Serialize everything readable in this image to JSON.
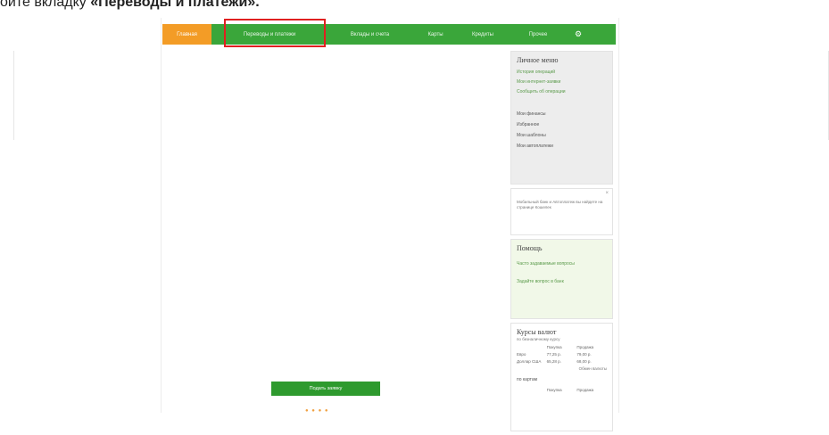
{
  "caption": {
    "prefix": "оите вкладку ",
    "bold": "«Переводы и платежи»."
  },
  "nav": {
    "tabs": [
      {
        "label": "Главная",
        "active": true
      },
      {
        "label": "Переводы и платежи",
        "active": false
      },
      {
        "label": "Вклады и счета",
        "active": false
      },
      {
        "label": "Карты",
        "active": false
      },
      {
        "label": "Кредиты",
        "active": false
      },
      {
        "label": "Прочее",
        "active": false
      }
    ],
    "settings_icon": "gear-icon"
  },
  "sidebar": {
    "cabinet": {
      "title": "Личное меню",
      "links": [
        "История операций",
        "Мои интернет-заявки",
        "Сообщить об операции"
      ],
      "items": [
        "Мои финансы",
        "Избранное",
        "Мои шаблоны",
        "Мои автоплатежи"
      ]
    },
    "promo": {
      "text": "Мобильный банк и Автоплатеж вы найдете на странице Кошелек"
    },
    "help": {
      "title": "Помощь",
      "links": [
        "Часто задаваемые вопросы",
        "Задайте вопрос в банк"
      ]
    },
    "rates": {
      "title": "Курсы валют",
      "subtitle": "по безналичному курсу",
      "headers": [
        "",
        "Покупка",
        "Продажа"
      ],
      "rows": [
        [
          "Евро",
          "77,25 р.",
          "79,00 р."
        ],
        [
          "Доллар США",
          "65,28 р.",
          "68,00 р."
        ]
      ],
      "note": "Обмен валюты",
      "footer": "по картам",
      "footer_headers": [
        "",
        "Покупка",
        "Продажа"
      ]
    }
  },
  "main": {
    "button_label": "Подать заявку",
    "dots": "● ● ● ●"
  },
  "colors": {
    "nav_green": "#3aa63a",
    "active_orange": "#f39c26",
    "highlight_red": "#e02020"
  }
}
